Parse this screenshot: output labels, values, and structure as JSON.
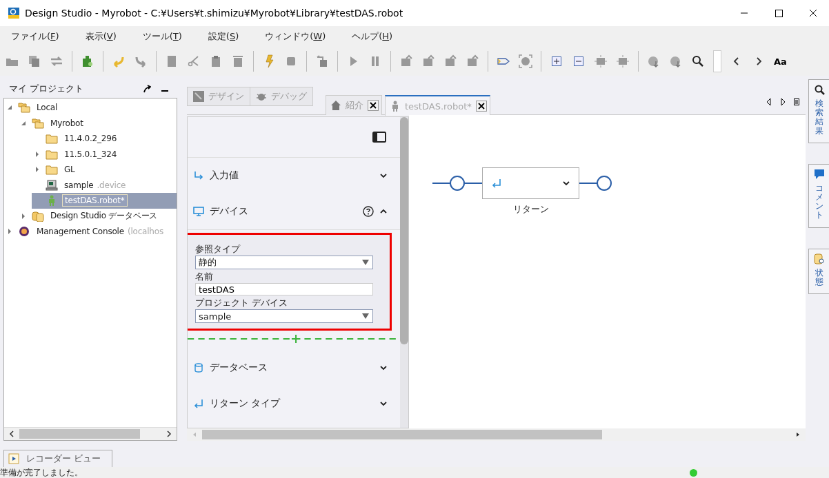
{
  "window": {
    "title": "Design Studio - Myrobot - C:¥Users¥t.shimizu¥Myrobot¥Library¥testDAS.robot"
  },
  "menu": [
    {
      "before": "ファイル(",
      "key": "F",
      "after": ")"
    },
    {
      "before": "表示(",
      "key": "V",
      "after": ")"
    },
    {
      "before": "ツール(",
      "key": "T",
      "after": ")"
    },
    {
      "before": "設定(",
      "key": "S",
      "after": ")"
    },
    {
      "before": "ウィンドウ(",
      "key": "W",
      "after": ")"
    },
    {
      "before": "ヘルプ(",
      "key": "H",
      "after": ")"
    }
  ],
  "toolbar": {
    "font_button": "Aa"
  },
  "project_panel": {
    "title": "マイ プロジェクト",
    "tree": [
      {
        "label": "Local",
        "kind": "folders",
        "expanded": true,
        "selected": false,
        "children": [
          {
            "label": "Myrobot",
            "kind": "folders",
            "expanded": true,
            "selected": false,
            "children": [
              {
                "label": "11.4.0.2_296",
                "kind": "folder",
                "selected": false
              },
              {
                "label": "11.5.0.1_324",
                "kind": "folder",
                "expanded": false,
                "selected": false
              },
              {
                "label": "GL",
                "kind": "folder",
                "expanded": false,
                "selected": false
              },
              {
                "label": "sample",
                "suffix": ".device",
                "kind": "device",
                "selected": false
              },
              {
                "label": "testDAS.robot*",
                "kind": "robot",
                "selected": true
              }
            ]
          },
          {
            "label": "Design Studio データベース",
            "kind": "database",
            "expanded": false,
            "selected": false
          }
        ]
      },
      {
        "label": "Management Console",
        "suffix": "(localhos",
        "kind": "console",
        "expanded": false,
        "selected": false
      }
    ]
  },
  "mode_tabs": [
    {
      "label": "デザイン",
      "kind": "design",
      "disabled": true
    },
    {
      "label": "デバッグ",
      "kind": "debug",
      "disabled": true
    }
  ],
  "editor_tabs": [
    {
      "label": "紹介",
      "kind": "home",
      "selected": false
    },
    {
      "label": "testDAS.robot*",
      "kind": "robot",
      "selected": true
    }
  ],
  "properties": {
    "sections": [
      {
        "label": "入力値",
        "kind": "input",
        "expanded": false
      },
      {
        "label": "デバイス",
        "kind": "device",
        "expanded": true,
        "help": true,
        "highlighted": true,
        "fields": [
          {
            "label": "参照タイプ",
            "kind": "dropdown",
            "value": "静的"
          },
          {
            "label": "名前",
            "kind": "text",
            "value": "testDAS"
          },
          {
            "label": "プロジェクト デバイス",
            "kind": "dropdown",
            "value": "sample"
          }
        ]
      },
      {
        "label": "データベース",
        "kind": "database",
        "expanded": false
      },
      {
        "label": "リターン タイプ",
        "kind": "return",
        "expanded": false
      }
    ]
  },
  "canvas": {
    "step": {
      "label": "リターン"
    }
  },
  "side_tabs": [
    {
      "label": "検索結果",
      "kind": "search"
    },
    {
      "label": "コメント",
      "kind": "comment"
    },
    {
      "label": "状態",
      "kind": "state"
    }
  ],
  "bottom_tab": {
    "label": "レコーダー ビュー"
  },
  "status_bar": {
    "message": "準備が完了しました。"
  }
}
